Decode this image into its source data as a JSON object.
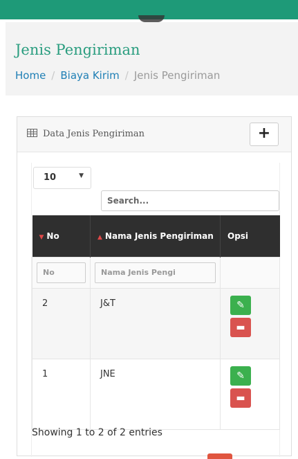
{
  "page": {
    "title": "Jenis Pengiriman",
    "breadcrumb": [
      "Home",
      "Biaya Kirim",
      "Jenis Pengiriman"
    ]
  },
  "card": {
    "title": "Data Jenis Pengiriman",
    "add_label": "+"
  },
  "table": {
    "length_value": "10",
    "search_placeholder": "Search...",
    "columns": [
      "No",
      "Nama Jenis Pengiriman",
      "Opsi"
    ],
    "filters": [
      "No",
      "Nama Jenis Pengi"
    ],
    "rows": [
      {
        "no": "2",
        "nama": "J&T"
      },
      {
        "no": "1",
        "nama": "JNE"
      }
    ],
    "info": "Showing 1 to 2 of 2 entries"
  },
  "icons": {
    "edit": "pencil-icon",
    "delete": "trash-icon",
    "card": "table-grid-icon"
  },
  "colors": {
    "brand": "#1e9a78",
    "title": "#2a9d7f",
    "link": "#1f7fb5",
    "edit": "#3bb04e",
    "delete": "#d9534f",
    "table_header": "#2f2f2f"
  }
}
